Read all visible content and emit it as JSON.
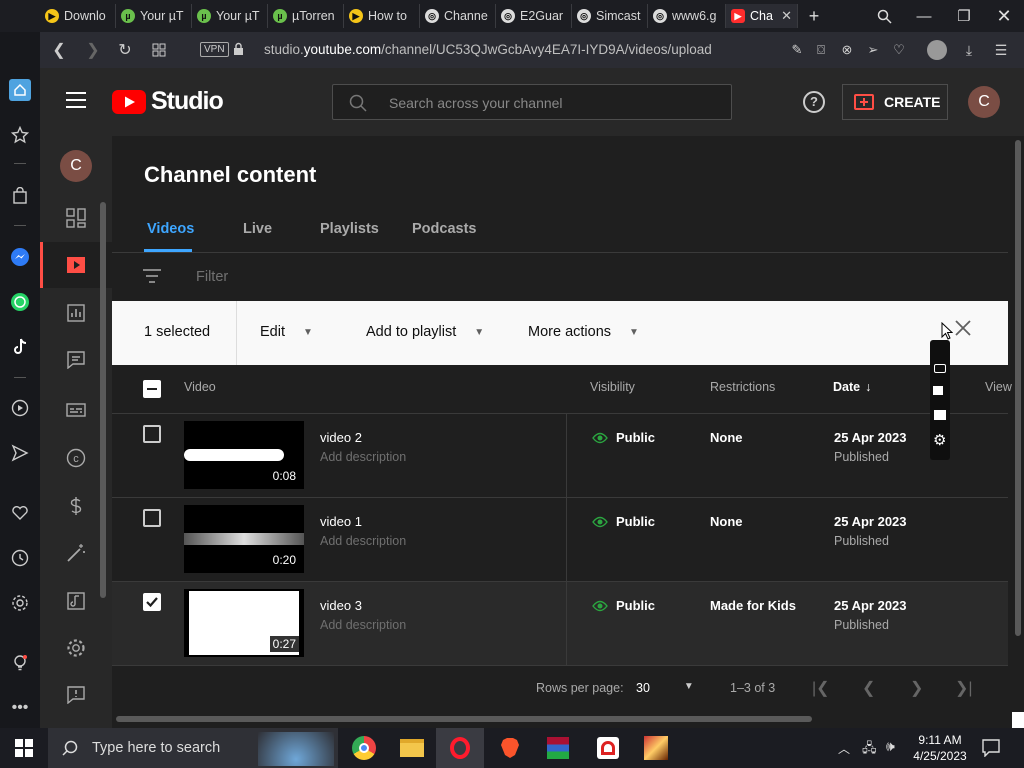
{
  "browser": {
    "tabs": [
      {
        "label": "Downlo",
        "color": "#f5c518"
      },
      {
        "label": "Your µT",
        "color": "#6ac04c"
      },
      {
        "label": "Your µT",
        "color": "#6ac04c"
      },
      {
        "label": "µTorren",
        "color": "#6ac04c"
      },
      {
        "label": "How to",
        "color": "#f5c518"
      },
      {
        "label": "Channe",
        "color": "#dcdcdc"
      },
      {
        "label": "E2Guar",
        "color": "#dcdcdc"
      },
      {
        "label": "Simcast",
        "color": "#dcdcdc"
      },
      {
        "label": "www6.g",
        "color": "#dcdcdc"
      },
      {
        "label": "Cha",
        "color": "#ff2d2d"
      }
    ],
    "vpn_label": "VPN",
    "url_prefix": "studio.",
    "url_domain": "youtube.com",
    "url_path": "/channel/UC53QJwGcbAvy4EA7I-IYD9A/videos/upload"
  },
  "studio": {
    "logo_text": "Studio",
    "search_placeholder": "Search across your channel",
    "create_label": "CREATE",
    "avatar_letter": "C"
  },
  "page": {
    "title": "Channel content",
    "tabs": [
      "Videos",
      "Live",
      "Playlists",
      "Podcasts"
    ],
    "filter_placeholder": "Filter"
  },
  "action_bar": {
    "selected_text": "1 selected",
    "edit_label": "Edit",
    "add_playlist_label": "Add to playlist",
    "more_actions_label": "More actions"
  },
  "table": {
    "headers": {
      "video": "Video",
      "visibility": "Visibility",
      "restrictions": "Restrictions",
      "date": "Date",
      "views": "View"
    },
    "rows": [
      {
        "title": "video 2",
        "description": "Add description",
        "duration": "0:08",
        "visibility": "Public",
        "restrictions": "None",
        "date": "25 Apr 2023",
        "status": "Published",
        "checked": false
      },
      {
        "title": "video 1",
        "description": "Add description",
        "duration": "0:20",
        "visibility": "Public",
        "restrictions": "None",
        "date": "25 Apr 2023",
        "status": "Published",
        "checked": false
      },
      {
        "title": "video 3",
        "description": "Add description",
        "duration": "0:27",
        "visibility": "Public",
        "restrictions": "Made for Kids",
        "date": "25 Apr 2023",
        "status": "Published",
        "checked": true
      }
    ]
  },
  "pagination": {
    "rows_per_page_label": "Rows per page:",
    "rows_per_page_value": "30",
    "range_text": "1–3 of 3"
  },
  "taskbar": {
    "search_placeholder": "Type here to search",
    "time": "9:11 AM",
    "date": "4/25/2023"
  },
  "colors": {
    "accent_blue": "#3ea6ff",
    "create_red": "#ff4e45",
    "yt_red": "#ff0000",
    "public_green": "#2ba640"
  }
}
